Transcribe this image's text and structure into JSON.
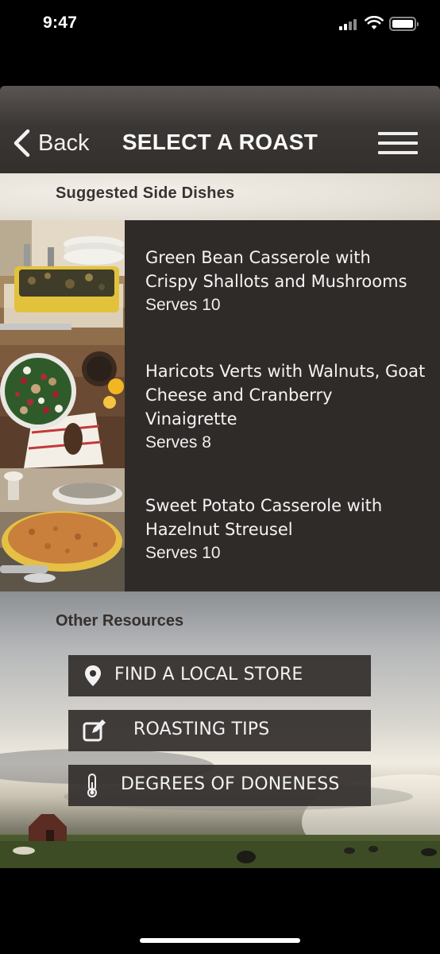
{
  "status_bar": {
    "time": "9:47"
  },
  "nav": {
    "back_label": "Back",
    "title": "SELECT A ROAST"
  },
  "section_header": "Suggested Side Dishes",
  "dishes": [
    {
      "name_line1": "Green Bean Casserole with",
      "name_line2": "Crispy Shallots and Mushrooms",
      "name_line3": "",
      "serves": "Serves 10"
    },
    {
      "name_line1": "Haricots Verts with Walnuts, Goat",
      "name_line2": "Cheese and Cranberry",
      "name_line3": "Vinaigrette",
      "serves": "Serves 8"
    },
    {
      "name_line1": "Sweet Potato Casserole with",
      "name_line2": "Hazelnut Streusel",
      "name_line3": "",
      "serves": "Serves 10"
    }
  ],
  "resources": {
    "title": "Other Resources",
    "buttons": [
      {
        "label": "FIND A LOCAL STORE",
        "icon": "location-pin-icon"
      },
      {
        "label": "ROASTING TIPS",
        "icon": "edit-icon"
      },
      {
        "label": "DEGREES OF DONENESS",
        "icon": "thermometer-icon"
      }
    ]
  }
}
